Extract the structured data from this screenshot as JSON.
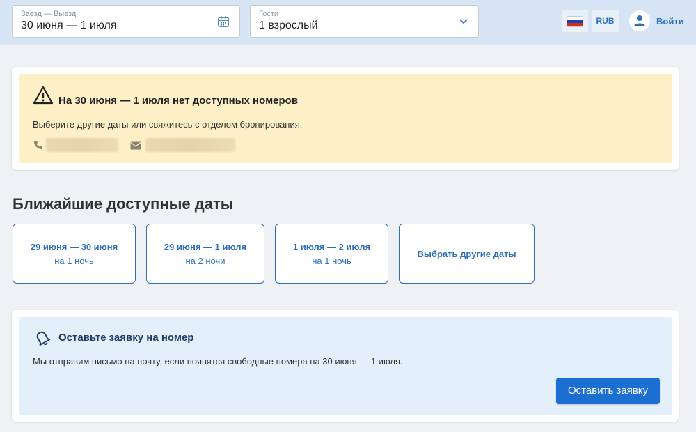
{
  "search": {
    "dates_label": "Заезд — Выезд",
    "dates_value": "30 июня — 1 июля",
    "guests_label": "Гости",
    "guests_value": "1 взрослый"
  },
  "header": {
    "language_flag": "russia-flag",
    "currency": "RUB",
    "login_label": "Войти"
  },
  "warning": {
    "title": "На 30 июня — 1 июля нет доступных номеров",
    "text": "Выберите другие даты или свяжитесь с отделом бронирования."
  },
  "nearest": {
    "title": "Ближайшие доступные даты",
    "options": [
      {
        "dates": "29 июня — 30 июня",
        "nights": "на 1 ночь"
      },
      {
        "dates": "29 июня — 1 июля",
        "nights": "на 2 ночи"
      },
      {
        "dates": "1 июля — 2 июля",
        "nights": "на 1 ночь"
      }
    ],
    "other_label": "Выбрать другие даты"
  },
  "request": {
    "title": "Оставьте заявку на номер",
    "text": "Мы отправим письмо на почту, если появятся свободные номера на 30 июня — 1 июля.",
    "button": "Оставить заявку"
  },
  "colors": {
    "accent": "#2d6fb9",
    "button": "#1a6fd0",
    "warning_bg": "#fdefc6",
    "info_bg": "#e3f0fb",
    "header_bg": "#d6e4f4"
  }
}
